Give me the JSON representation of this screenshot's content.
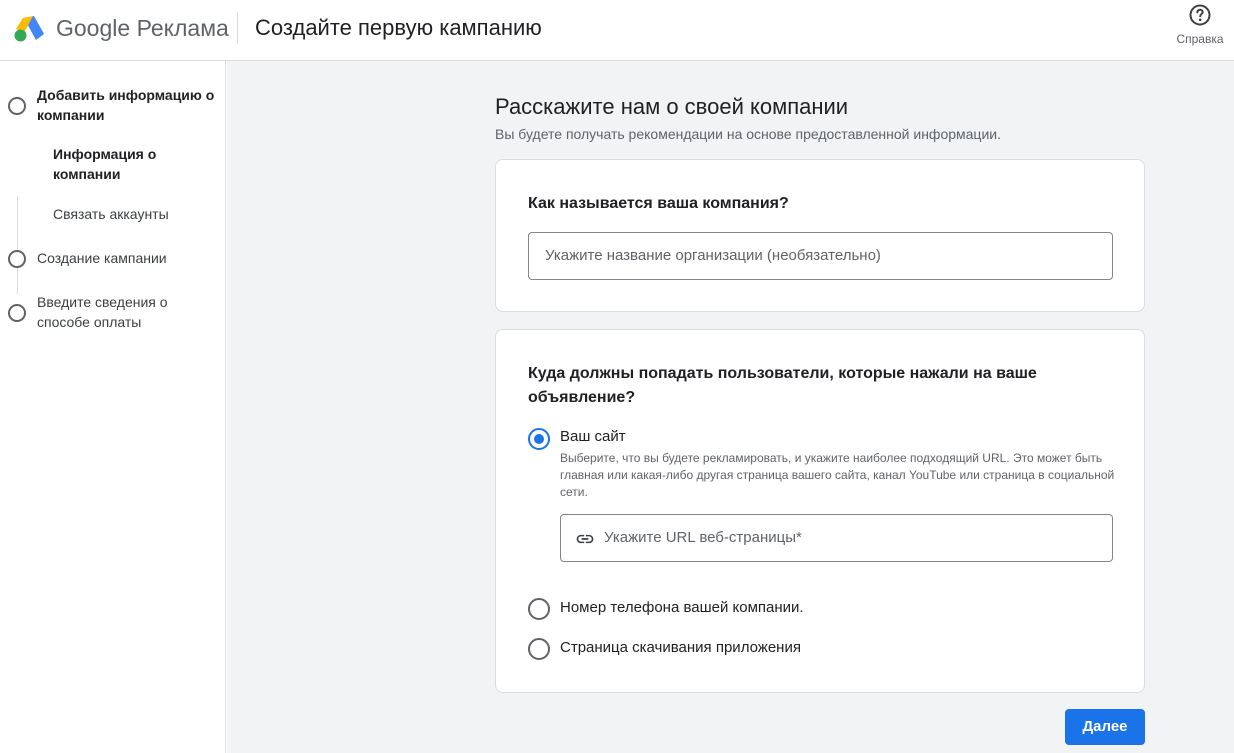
{
  "header": {
    "brand_google": "Google",
    "brand_product": "Реклама",
    "title": "Создайте первую кампанию",
    "help_label": "Справка"
  },
  "sidebar": {
    "steps": [
      {
        "label": "Добавить информацию о компании",
        "bold": true
      },
      {
        "label": "Создание кампании"
      },
      {
        "label": "Введите сведения о способе оплаты"
      }
    ],
    "substeps": [
      {
        "label": "Информация о компании",
        "active": true
      },
      {
        "label": "Связать аккаунты",
        "active": false
      }
    ]
  },
  "main": {
    "title": "Расскажите нам о своей компании",
    "subtitle": "Вы будете получать рекомендации на основе предоставленной информации.",
    "company_card": {
      "question": "Как называется ваша компания?",
      "input_placeholder": "Укажите название организации (необязательно)"
    },
    "destination_card": {
      "question": "Куда должны попадать пользователи, которые нажали на ваше объявление?",
      "options": [
        {
          "label": "Ваш сайт",
          "checked": true,
          "description": "Выберите, что вы будете рекламировать, и укажите наиболее подходящий URL. Это может быть главная или какая-либо другая страница вашего сайта, канал YouTube или страница в социальной сети."
        },
        {
          "label": "Номер телефона вашей компании.",
          "checked": false
        },
        {
          "label": "Страница скачивания приложения",
          "checked": false
        }
      ],
      "url_placeholder": "Укажите URL веб-страницы*"
    },
    "next_button": "Далее"
  },
  "colors": {
    "accent": "#1a73e8",
    "background": "#f1f3f4",
    "border": "#dadce0"
  },
  "icons": [
    "google-ads-logo",
    "help-icon",
    "link-icon"
  ]
}
